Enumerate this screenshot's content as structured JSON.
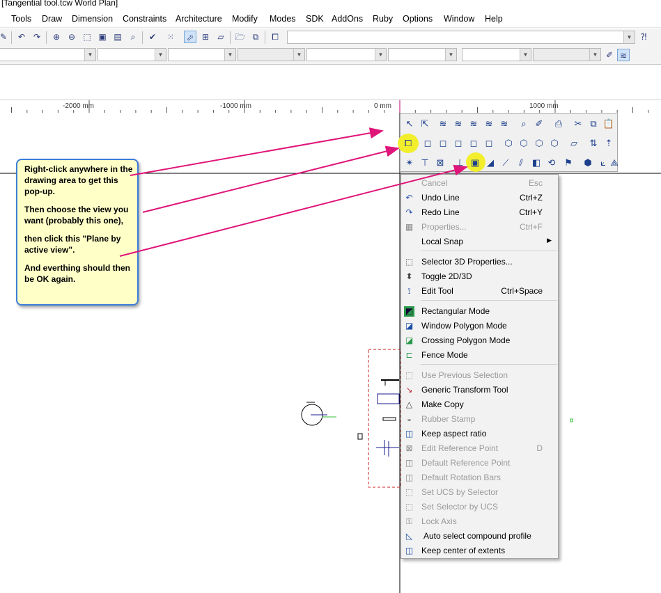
{
  "window": {
    "title": "[Tangential tool.tcw World Plan]"
  },
  "menubar": {
    "items": [
      "Tools",
      "Draw",
      "Dimension",
      "Constraints",
      "Architecture",
      "Modify",
      "Modes",
      "SDK",
      "AddOns",
      "Ruby",
      "Options",
      "Window",
      "Help"
    ]
  },
  "ruler": {
    "labels": [
      "-2000 mm",
      "-1000 mm",
      "0 mm",
      "1000 mm"
    ]
  },
  "callout": {
    "paragraphs": [
      "Right-click anywhere in the drawing area to get this pop-up.",
      "Then choose the view you want (probably this one),",
      "then click this \"Plane by active view\".",
      "And everthing should then be OK again."
    ]
  },
  "context_menu": {
    "items": [
      {
        "icon": "",
        "label": "Cancel",
        "shortcut": "Esc",
        "disabled": true
      },
      {
        "icon": "undo-icon",
        "label": "Undo Line",
        "shortcut": "Ctrl+Z",
        "disabled": false
      },
      {
        "icon": "redo-icon",
        "label": "Redo Line",
        "shortcut": "Ctrl+Y",
        "disabled": false
      },
      {
        "icon": "properties-icon",
        "label": "Properties...",
        "shortcut": "Ctrl+F",
        "disabled": true
      },
      {
        "icon": "",
        "label": "Local Snap",
        "shortcut": "",
        "disabled": false,
        "submenu": true
      },
      {
        "separator": true
      },
      {
        "icon": "selector-3d-icon",
        "label": "Selector 3D Properties...",
        "shortcut": "",
        "disabled": false
      },
      {
        "icon": "toggle-2d3d-icon",
        "label": "Toggle 2D/3D",
        "shortcut": "",
        "disabled": false
      },
      {
        "icon": "edit-tool-icon",
        "label": "Edit Tool",
        "shortcut": "Ctrl+Space",
        "disabled": false
      },
      {
        "separator": true
      },
      {
        "icon": "rectangular-mode-icon",
        "label": "Rectangular Mode",
        "shortcut": "",
        "disabled": false
      },
      {
        "icon": "window-polygon-icon",
        "label": "Window Polygon Mode",
        "shortcut": "",
        "disabled": false
      },
      {
        "icon": "crossing-polygon-icon",
        "label": "Crossing Polygon Mode",
        "shortcut": "",
        "disabled": false
      },
      {
        "icon": "fence-mode-icon",
        "label": "Fence Mode",
        "shortcut": "",
        "disabled": false
      },
      {
        "separator": true
      },
      {
        "icon": "previous-selection-icon",
        "label": "Use Previous Selection",
        "shortcut": "",
        "disabled": true
      },
      {
        "icon": "transform-tool-icon",
        "label": "Generic Transform Tool",
        "shortcut": "",
        "disabled": false
      },
      {
        "icon": "make-copy-icon",
        "label": "Make Copy",
        "shortcut": "",
        "disabled": false
      },
      {
        "icon": "rubber-stamp-icon",
        "label": "Rubber Stamp",
        "shortcut": "",
        "disabled": true
      },
      {
        "icon": "aspect-ratio-icon",
        "label": "Keep aspect ratio",
        "shortcut": "",
        "disabled": false
      },
      {
        "icon": "reference-point-icon",
        "label": "Edit Reference Point",
        "shortcut": "D",
        "disabled": true
      },
      {
        "icon": "default-reference-icon",
        "label": "Default Reference Point",
        "shortcut": "",
        "disabled": true
      },
      {
        "icon": "rotation-bars-icon",
        "label": "Default Rotation Bars",
        "shortcut": "",
        "disabled": true
      },
      {
        "icon": "ucs-by-selector-icon",
        "label": "Set UCS by Selector",
        "shortcut": "",
        "disabled": true
      },
      {
        "icon": "selector-by-ucs-icon",
        "label": "Set Selector by UCS",
        "shortcut": "",
        "disabled": true
      },
      {
        "icon": "lock-axis-icon",
        "label": "Lock Axis",
        "shortcut": "",
        "disabled": true
      },
      {
        "icon": "compound-profile-icon",
        "label": "Auto select compound profile",
        "shortcut": "",
        "disabled": false
      },
      {
        "icon": "center-extents-icon",
        "label": "Keep center of extents",
        "shortcut": "",
        "disabled": false
      }
    ]
  },
  "colors": {
    "accent_callout_border": "#3b7dd8",
    "callout_fill": "#ffffc8",
    "arrow": "#e0157a",
    "highlight": "#f2ee2c",
    "selection_box": "#cc2222"
  }
}
